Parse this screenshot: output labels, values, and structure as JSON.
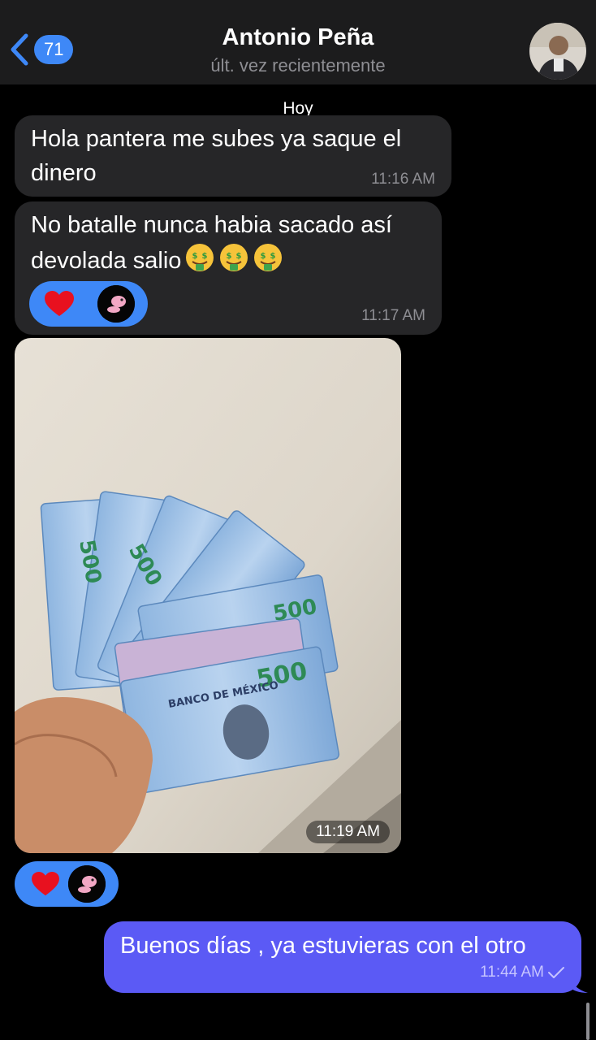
{
  "header": {
    "unread_count": "71",
    "contact_name": "Antonio Peña",
    "status": "últ. vez recientemente"
  },
  "date_separator": "Hoy",
  "messages": [
    {
      "text_line1": "Hola pantera me subes ya saque el",
      "text_line2": "dinero",
      "time": "11:16 AM"
    },
    {
      "text_line1": "No batalle nunca habia sacado así",
      "text_line2": "devolada salio",
      "emojis": [
        "money-mouth-face-icon",
        "money-mouth-face-icon",
        "money-mouth-face-icon"
      ],
      "time": "11:17 AM",
      "reaction": "heart-icon"
    },
    {
      "type": "photo",
      "time": "11:19 AM",
      "reaction": "heart-icon",
      "banknote_value": "500",
      "banknote_issuer": "BANCO DE MÉXICO"
    },
    {
      "outgoing": true,
      "text": "Buenos días , ya estuvieras con el otro",
      "time": "11:44 AM",
      "status_icon": "checkmark-icon"
    }
  ],
  "colors": {
    "accent": "#3e88f7",
    "outgoing_bubble": "#5b5af5",
    "incoming_bubble": "#262628",
    "header_bg": "#1c1c1d"
  }
}
